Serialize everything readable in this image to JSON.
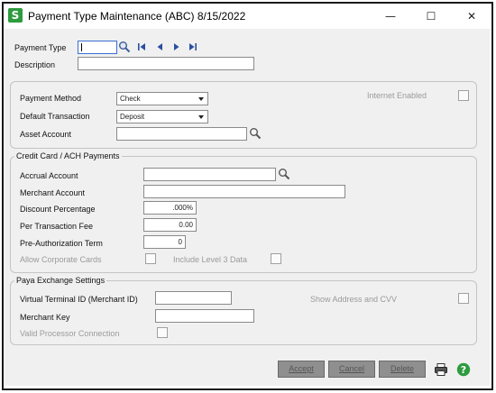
{
  "window": {
    "app_icon_letter": "S",
    "title": "Payment Type Maintenance (ABC) 8/15/2022",
    "minimize_glyph": "—",
    "maximize_glyph": "☐",
    "close_glyph": "✕"
  },
  "header": {
    "payment_type_label": "Payment Type",
    "payment_type_value": "",
    "description_label": "Description",
    "description_value": ""
  },
  "general": {
    "payment_method_label": "Payment Method",
    "payment_method_value": "Check",
    "default_transaction_label": "Default Transaction",
    "default_transaction_value": "Deposit",
    "asset_account_label": "Asset Account",
    "asset_account_value": "",
    "internet_enabled_label": "Internet Enabled"
  },
  "credit_card": {
    "group_title": "Credit Card / ACH Payments",
    "accrual_account_label": "Accrual Account",
    "accrual_account_value": "",
    "merchant_account_label": "Merchant Account",
    "merchant_account_value": "",
    "discount_percentage_label": "Discount Percentage",
    "discount_percentage_value": ".000%",
    "per_transaction_fee_label": "Per Transaction Fee",
    "per_transaction_fee_value": "0.00",
    "pre_auth_term_label": "Pre-Authorization Term",
    "pre_auth_term_value": "0",
    "allow_corporate_cards_label": "Allow Corporate Cards",
    "include_level3_label": "Include Level 3 Data"
  },
  "paya": {
    "group_title": "Paya Exchange Settings",
    "virtual_terminal_label": "Virtual Terminal ID (Merchant ID)",
    "virtual_terminal_value": "",
    "merchant_key_label": "Merchant Key",
    "merchant_key_value": "",
    "show_address_cvv_label": "Show Address and CVV",
    "valid_processor_label": "Valid Processor Connection"
  },
  "buttons": {
    "accept": "Accept",
    "cancel": "Cancel",
    "delete": "Delete"
  },
  "icons": {
    "lookup": "magnifier-icon",
    "first": "first-record-icon",
    "previous": "previous-record-icon",
    "next": "next-record-icon",
    "last": "last-record-icon",
    "print": "printer-icon",
    "help": "help-icon"
  },
  "colors": {
    "app_icon": "#2e9b3e",
    "nav_arrows": "#2b4f9e",
    "help_icon": "#2e9b3e",
    "disabled_buttons": "#8f8f8f"
  }
}
